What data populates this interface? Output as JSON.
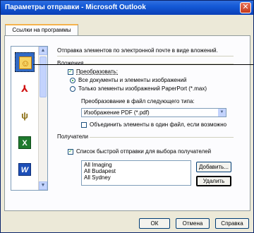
{
  "window": {
    "title": "Параметры отправки - Microsoft Outlook",
    "close_glyph": "✕"
  },
  "tab": {
    "label": "Ссылки на программы"
  },
  "description": "Отправка элементов по электронной почте в виде вложений.",
  "attachments": {
    "group_label": "Вложения",
    "convert_label": "Преобразовать:",
    "convert_checked": true,
    "radio_all": "Все документы и элементы изображений",
    "radio_paperport": "Только элементы изображений PaperPort (*.max)",
    "radio_selected": "all",
    "convert_to_label": "Преобразование в файл следующего типа:",
    "format_value": "Изображение PDF (*.pdf)",
    "combine_label": "Объединить элементы в один файл, если возможно",
    "combine_checked": false
  },
  "recipients": {
    "group_label": "Получатели",
    "quicklist_label": "Список быстрой отправки для выбора получателей",
    "quicklist_checked": true,
    "items": [
      "All Imaging",
      "All Budapest",
      "All Sydney"
    ],
    "add_label": "Добавить...",
    "remove_label": "Удалить"
  },
  "footer": {
    "ok_label": "ОК",
    "cancel_label": "Отмена",
    "help_label": "Справка"
  },
  "app_icons": [
    {
      "name": "paperport-icon",
      "glyph": "☺",
      "color": "#e8a400"
    },
    {
      "name": "acrobat-icon",
      "glyph": "⅄",
      "color": "#d01010"
    },
    {
      "name": "paint-icon",
      "glyph": "ψ",
      "color": "#8a6d12"
    },
    {
      "name": "excel-icon",
      "glyph": "X",
      "color": "#1f7a2e"
    },
    {
      "name": "word-icon",
      "glyph": "W",
      "color": "#1d4fb8"
    }
  ],
  "colors": {
    "titlebar": "#1459d6",
    "accent_check": "#21a121",
    "tab_highlight": "#f5b24c"
  }
}
